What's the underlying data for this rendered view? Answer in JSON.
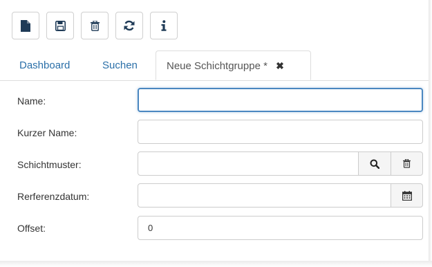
{
  "toolbar": {
    "buttons": [
      {
        "name": "new",
        "icon": "file-icon"
      },
      {
        "name": "save",
        "icon": "floppy-disk-icon"
      },
      {
        "name": "delete",
        "icon": "trash-icon"
      },
      {
        "name": "refresh",
        "icon": "refresh-icon"
      },
      {
        "name": "info",
        "icon": "info-icon"
      }
    ]
  },
  "tabs": [
    {
      "label": "Dashboard"
    },
    {
      "label": "Suchen"
    },
    {
      "label": "Neue Schichtgruppe *",
      "close_icon": "close-icon"
    }
  ],
  "form": {
    "name": {
      "label": "Name:",
      "value": ""
    },
    "short_name": {
      "label": "Kurzer Name:",
      "value": ""
    },
    "shift_pattern": {
      "label": "Schichtmuster:",
      "value": "",
      "search_icon": "search-icon",
      "clear_icon": "trash-icon"
    },
    "reference_date": {
      "label": "Rerferenzdatum:",
      "value": "",
      "calendar_icon": "calendar-icon"
    },
    "offset": {
      "label": "Offset:",
      "value": "0"
    }
  },
  "colors": {
    "tab_link": "#2a6fa8",
    "focus_border": "#4a87c0",
    "border": "#cccccc"
  }
}
